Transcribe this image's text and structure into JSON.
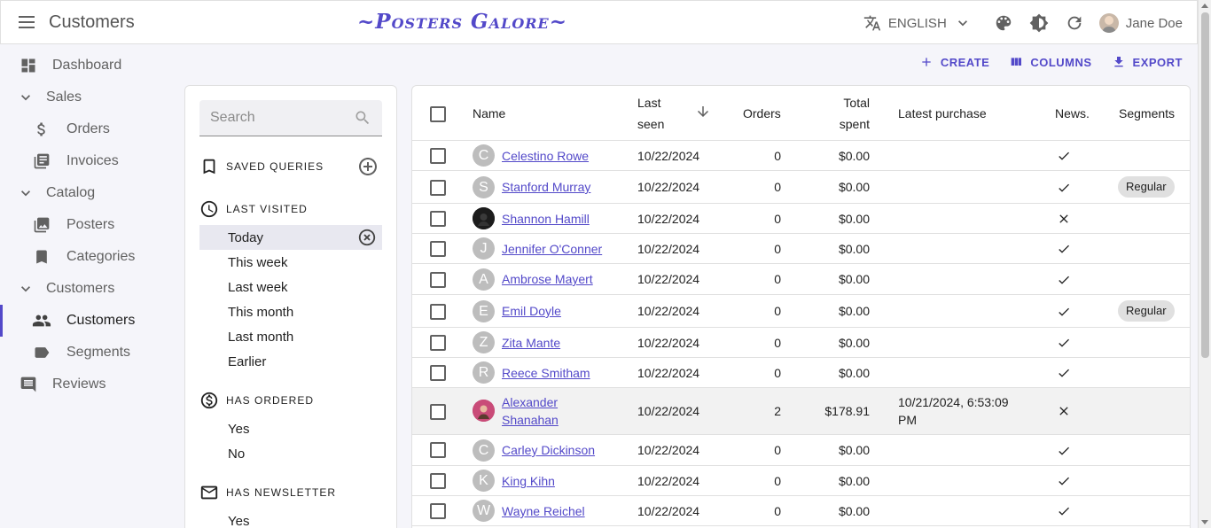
{
  "appbar": {
    "title": "Customers",
    "brand": "~Posters Galore~",
    "language": "ENGLISH",
    "user_name": "Jane Doe"
  },
  "sidebar": {
    "items": [
      {
        "label": "Dashboard",
        "icon": "dashboard-icon"
      },
      {
        "label": "Sales",
        "icon": "chevron-down-icon"
      },
      {
        "label": "Orders",
        "icon": "dollar-icon"
      },
      {
        "label": "Invoices",
        "icon": "invoice-icon"
      },
      {
        "label": "Catalog",
        "icon": "chevron-down-icon"
      },
      {
        "label": "Posters",
        "icon": "image-icon"
      },
      {
        "label": "Categories",
        "icon": "bookmark-icon"
      },
      {
        "label": "Customers",
        "icon": "chevron-down-icon"
      },
      {
        "label": "Customers",
        "icon": "people-icon"
      },
      {
        "label": "Segments",
        "icon": "label-icon"
      },
      {
        "label": "Reviews",
        "icon": "comment-icon"
      }
    ]
  },
  "filter": {
    "search_placeholder": "Search",
    "saved_queries": "SAVED QUERIES",
    "last_visited": "LAST VISITED",
    "last_visited_options": [
      "Today",
      "This week",
      "Last week",
      "This month",
      "Last month",
      "Earlier"
    ],
    "has_ordered": "HAS ORDERED",
    "has_ordered_options": [
      "Yes",
      "No"
    ],
    "has_newsletter": "HAS NEWSLETTER",
    "has_newsletter_options": [
      "Yes"
    ]
  },
  "toolbar": {
    "create": "CREATE",
    "columns": "COLUMNS",
    "export": "EXPORT"
  },
  "table": {
    "headers": {
      "name": "Name",
      "last_seen_1": "Last",
      "last_seen_2": "seen",
      "orders": "Orders",
      "total_1": "Total",
      "total_2": "spent",
      "latest": "Latest purchase",
      "news": "News.",
      "segments": "Segments"
    },
    "rows": [
      {
        "initial": "C",
        "name": "Celestino Rowe",
        "seen": "10/22/2024",
        "orders": "0",
        "total": "$0.00",
        "latest": "",
        "news": "yes",
        "segment": ""
      },
      {
        "initial": "S",
        "name": "Stanford Murray",
        "seen": "10/22/2024",
        "orders": "0",
        "total": "$0.00",
        "latest": "",
        "news": "yes",
        "segment": "Regular"
      },
      {
        "initial": "",
        "name": "Shannon Hamill",
        "seen": "10/22/2024",
        "orders": "0",
        "total": "$0.00",
        "latest": "",
        "news": "no",
        "segment": ""
      },
      {
        "initial": "J",
        "name": "Jennifer O'Conner",
        "seen": "10/22/2024",
        "orders": "0",
        "total": "$0.00",
        "latest": "",
        "news": "yes",
        "segment": ""
      },
      {
        "initial": "A",
        "name": "Ambrose Mayert",
        "seen": "10/22/2024",
        "orders": "0",
        "total": "$0.00",
        "latest": "",
        "news": "yes",
        "segment": ""
      },
      {
        "initial": "E",
        "name": "Emil Doyle",
        "seen": "10/22/2024",
        "orders": "0",
        "total": "$0.00",
        "latest": "",
        "news": "yes",
        "segment": "Regular"
      },
      {
        "initial": "Z",
        "name": "Zita Mante",
        "seen": "10/22/2024",
        "orders": "0",
        "total": "$0.00",
        "latest": "",
        "news": "yes",
        "segment": ""
      },
      {
        "initial": "R",
        "name": "Reece Smitham",
        "seen": "10/22/2024",
        "orders": "0",
        "total": "$0.00",
        "latest": "",
        "news": "yes",
        "segment": ""
      },
      {
        "initial": "",
        "name_1": "Alexander",
        "name_2": "Shanahan",
        "seen": "10/22/2024",
        "orders": "2",
        "total": "$178.91",
        "latest_1": "10/21/2024, 6:53:09",
        "latest_2": "PM",
        "news": "no",
        "segment": ""
      },
      {
        "initial": "C",
        "name": "Carley Dickinson",
        "seen": "10/22/2024",
        "orders": "0",
        "total": "$0.00",
        "latest": "",
        "news": "yes",
        "segment": ""
      },
      {
        "initial": "K",
        "name": "King Kihn",
        "seen": "10/22/2024",
        "orders": "0",
        "total": "$0.00",
        "latest": "",
        "news": "yes",
        "segment": ""
      },
      {
        "initial": "W",
        "name": "Wayne Reichel",
        "seen": "10/22/2024",
        "orders": "0",
        "total": "$0.00",
        "latest": "",
        "news": "yes",
        "segment": ""
      }
    ]
  },
  "colors": {
    "accent": "#5349c9",
    "text": "#212121",
    "muted": "#616161",
    "background": "#f5f5fa"
  }
}
